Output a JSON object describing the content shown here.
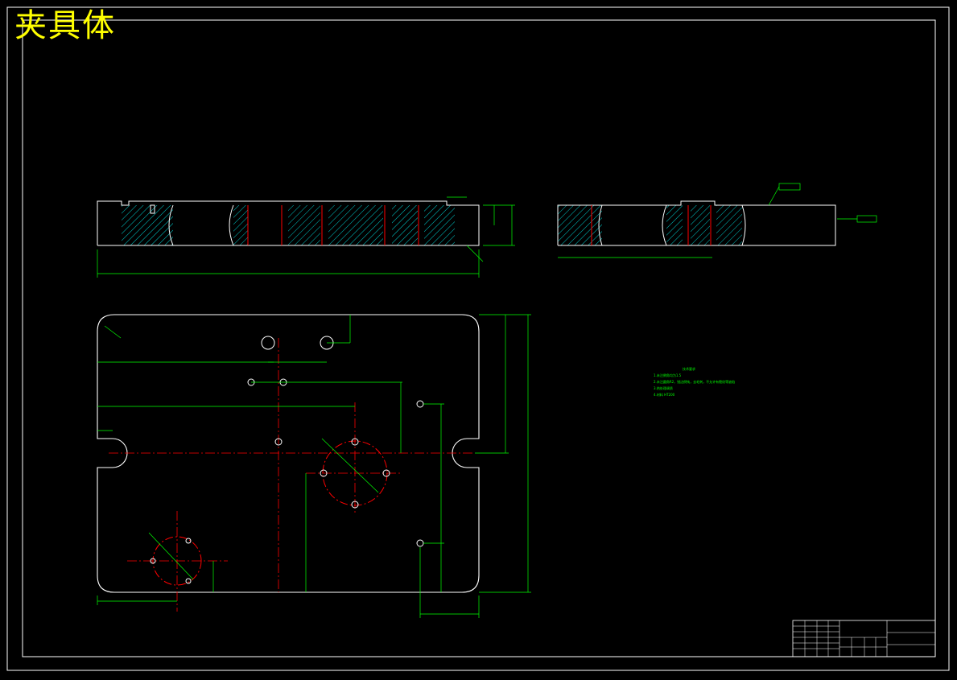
{
  "drawing": {
    "title": "夹具体",
    "tech_notes": {
      "heading": "技术要求",
      "lines": [
        "1.未注倒角均为1.5",
        "2.未注圆角R2，锐边倒钝，去毛刺，不允许有裂纹等缺陷",
        "3.热处理调质",
        "4.材料 HT200"
      ]
    }
  },
  "colors": {
    "background": "#000000",
    "outline": "#ffffff",
    "dimension": "#00ff00",
    "centerline": "#ff0000",
    "hatch": "#00ffff",
    "title": "#ffff00"
  }
}
